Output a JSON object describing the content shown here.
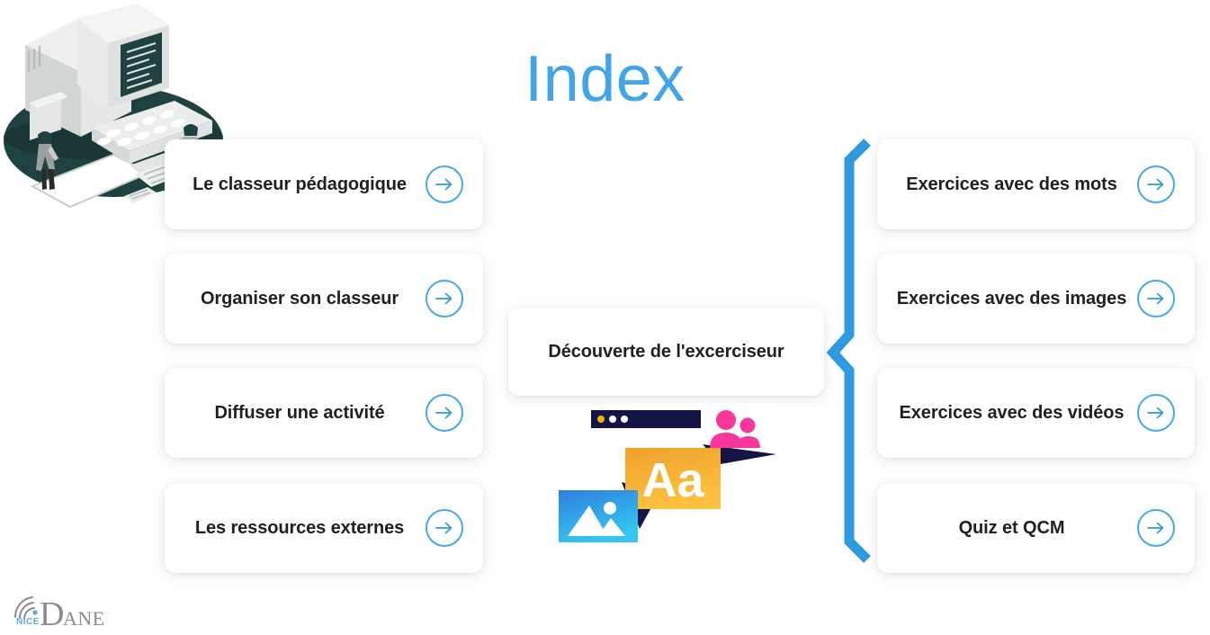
{
  "page": {
    "title": "Index",
    "title_color": "#41a5e8",
    "background": "#ffffff"
  },
  "colors": {
    "accent_blue": "#45a9e9",
    "brace_blue": "#2e9ae0",
    "text_dark": "#231f20",
    "illustration_navy": "#141447",
    "illustration_pink": "#f8369b",
    "illustration_orange": "#f5a623",
    "illustration_blue": "#2e9ae0",
    "computer_teal": "#1f413f",
    "computer_grey": "#d9dbdb",
    "logo_grey": "#8c8c8c",
    "logo_blue": "#5fa8dc"
  },
  "left_column": {
    "items": [
      {
        "label": "Le classeur pédagogique",
        "arrow_icon": "arrow-right-circle-icon"
      },
      {
        "label": "Organiser son classeur",
        "arrow_icon": "arrow-right-circle-icon"
      },
      {
        "label": "Diffuser une activité",
        "arrow_icon": "arrow-right-circle-icon"
      },
      {
        "label": "Les ressources externes",
        "arrow_icon": "arrow-right-circle-icon"
      }
    ]
  },
  "center": {
    "card_label": "Découverte de l'excerciseur",
    "illustration": {
      "name": "media-types-illustration",
      "browser_bar_dots": [
        "#f5b301",
        "#ffffff",
        "#ffffff"
      ],
      "text_card_label": "Aa",
      "people_icon": "people-icon",
      "image_icon": "image-placeholder-icon"
    }
  },
  "right_column": {
    "brace_icon": "curly-brace-icon",
    "items": [
      {
        "label": "Exercices avec des mots",
        "arrow_icon": "arrow-right-circle-icon"
      },
      {
        "label": "Exercices avec des images",
        "arrow_icon": "arrow-right-circle-icon"
      },
      {
        "label": "Exercices avec des vidéos",
        "arrow_icon": "arrow-right-circle-icon"
      },
      {
        "label": "Quiz et QCM",
        "arrow_icon": "arrow-right-circle-icon"
      }
    ]
  },
  "decorations": {
    "computer_illustration": "retro-computer-isometric-illustration"
  },
  "logo": {
    "mark": "wifi-arc-icon",
    "small_text": "NICE",
    "big_letter": "D",
    "rest_text": "ANE",
    "full_text": "NICE DANE"
  }
}
